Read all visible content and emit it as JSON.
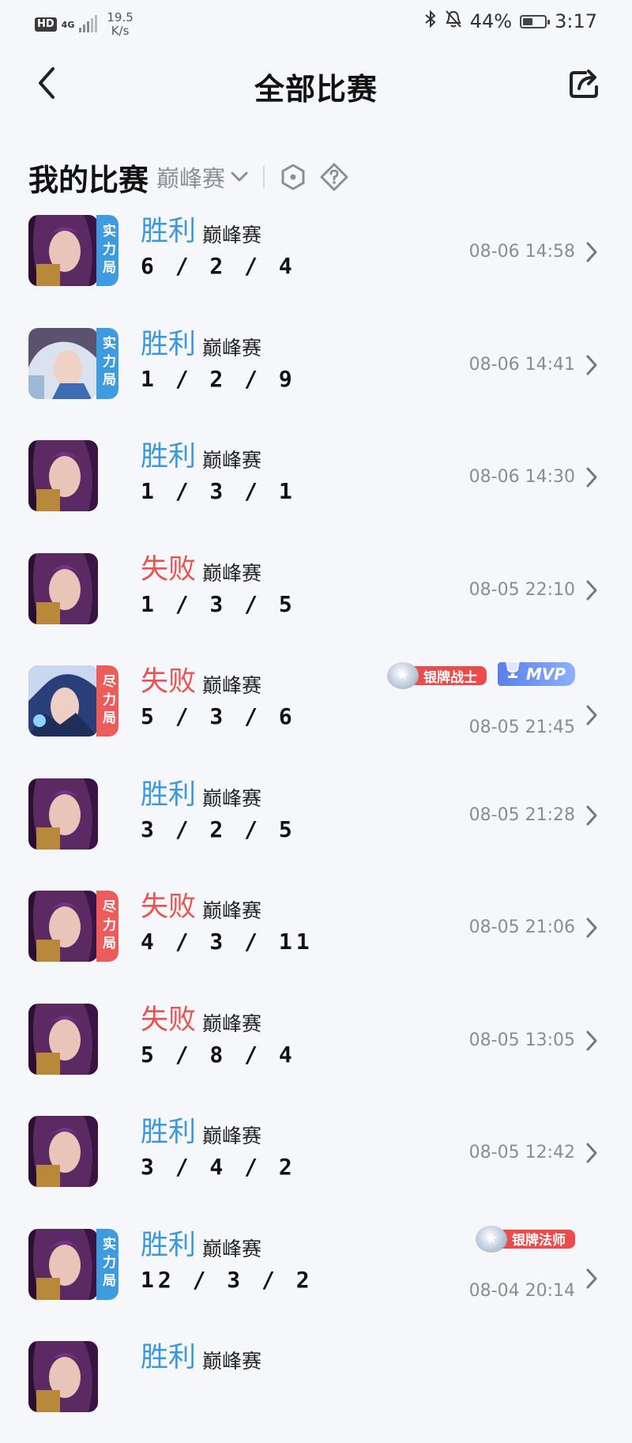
{
  "status_bar": {
    "hd": "HD",
    "network": "4G",
    "speed_value": "19.5",
    "speed_unit": "K/s",
    "battery": "44%",
    "time": "3:17"
  },
  "header": {
    "title": "全部比赛"
  },
  "section": {
    "title": "我的比赛",
    "mode_filter": "巅峰赛"
  },
  "colors": {
    "win": "#3b98dc",
    "lose": "#e65454",
    "tag_blue": "#3f9be0",
    "tag_red": "#ee5b5b"
  },
  "matches": [
    {
      "result": "胜利",
      "mode": "巅峰赛",
      "kda": "6 / 2 / 4",
      "time": "08-06 14:58",
      "tag": "实力局"
    },
    {
      "result": "胜利",
      "mode": "巅峰赛",
      "kda": "1 / 2 / 9",
      "time": "08-06 14:41",
      "tag": "实力局"
    },
    {
      "result": "胜利",
      "mode": "巅峰赛",
      "kda": "1 / 3 / 1",
      "time": "08-06 14:30"
    },
    {
      "result": "失败",
      "mode": "巅峰赛",
      "kda": "1 / 3 / 5",
      "time": "08-05 22:10"
    },
    {
      "result": "失败",
      "mode": "巅峰赛",
      "kda": "5 / 3 / 6",
      "time": "08-05 21:45",
      "tag": "尽力局",
      "badges": [
        "银牌战士",
        "MVP"
      ]
    },
    {
      "result": "胜利",
      "mode": "巅峰赛",
      "kda": "3 / 2 / 5",
      "time": "08-05 21:28"
    },
    {
      "result": "失败",
      "mode": "巅峰赛",
      "kda": "4 / 3 / 11",
      "time": "08-05 21:06",
      "tag": "尽力局"
    },
    {
      "result": "失败",
      "mode": "巅峰赛",
      "kda": "5 / 8 / 4",
      "time": "08-05 13:05"
    },
    {
      "result": "胜利",
      "mode": "巅峰赛",
      "kda": "3 / 4 / 2",
      "time": "08-05 12:42"
    },
    {
      "result": "胜利",
      "mode": "巅峰赛",
      "kda": "12 / 3 / 2",
      "time": "08-04 20:14",
      "tag": "实力局",
      "badges": [
        "银牌法师"
      ]
    },
    {
      "result": "胜利",
      "mode": "巅峰赛"
    }
  ]
}
